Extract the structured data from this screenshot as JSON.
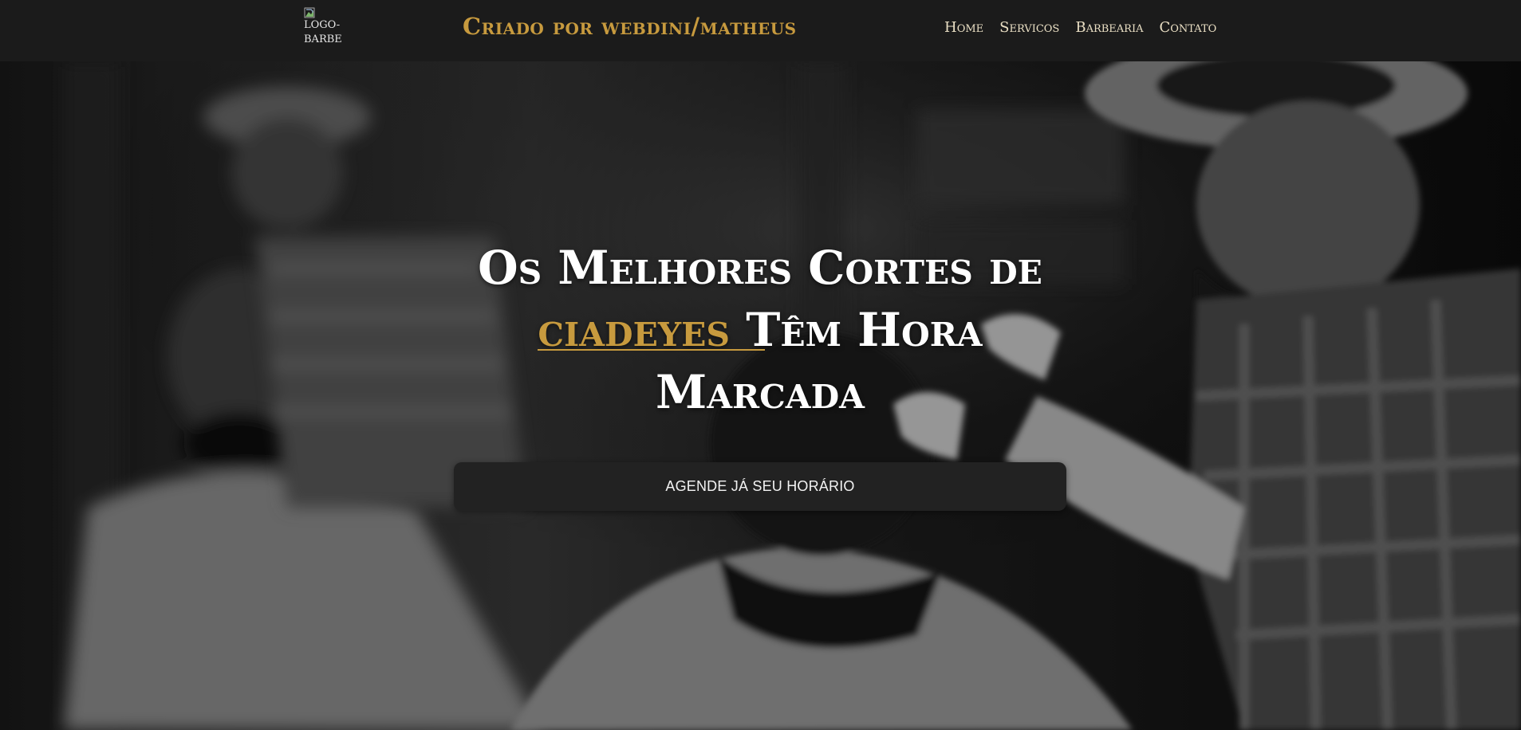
{
  "header": {
    "logo_alt": "LOGO-BARBE",
    "brand_title": "Criado por webdini/matheus",
    "nav": [
      {
        "label": "Home"
      },
      {
        "label": "Servicos"
      },
      {
        "label": "Barbearia"
      },
      {
        "label": "Contato"
      }
    ]
  },
  "hero": {
    "headline_part1": "Os Melhores Cortes de",
    "headline_accent": "ciadeyes",
    "headline_part2": "Têm Hora Marcada",
    "cta_label": "AGENDE JÁ SEU HORÁRIO"
  },
  "colors": {
    "accent": "#c79a3e",
    "header_bg": "#1b1b1b",
    "cta_bg": "#222222",
    "nav_text": "#eadfc4"
  },
  "icons": {
    "logo": "broken-image-icon"
  }
}
